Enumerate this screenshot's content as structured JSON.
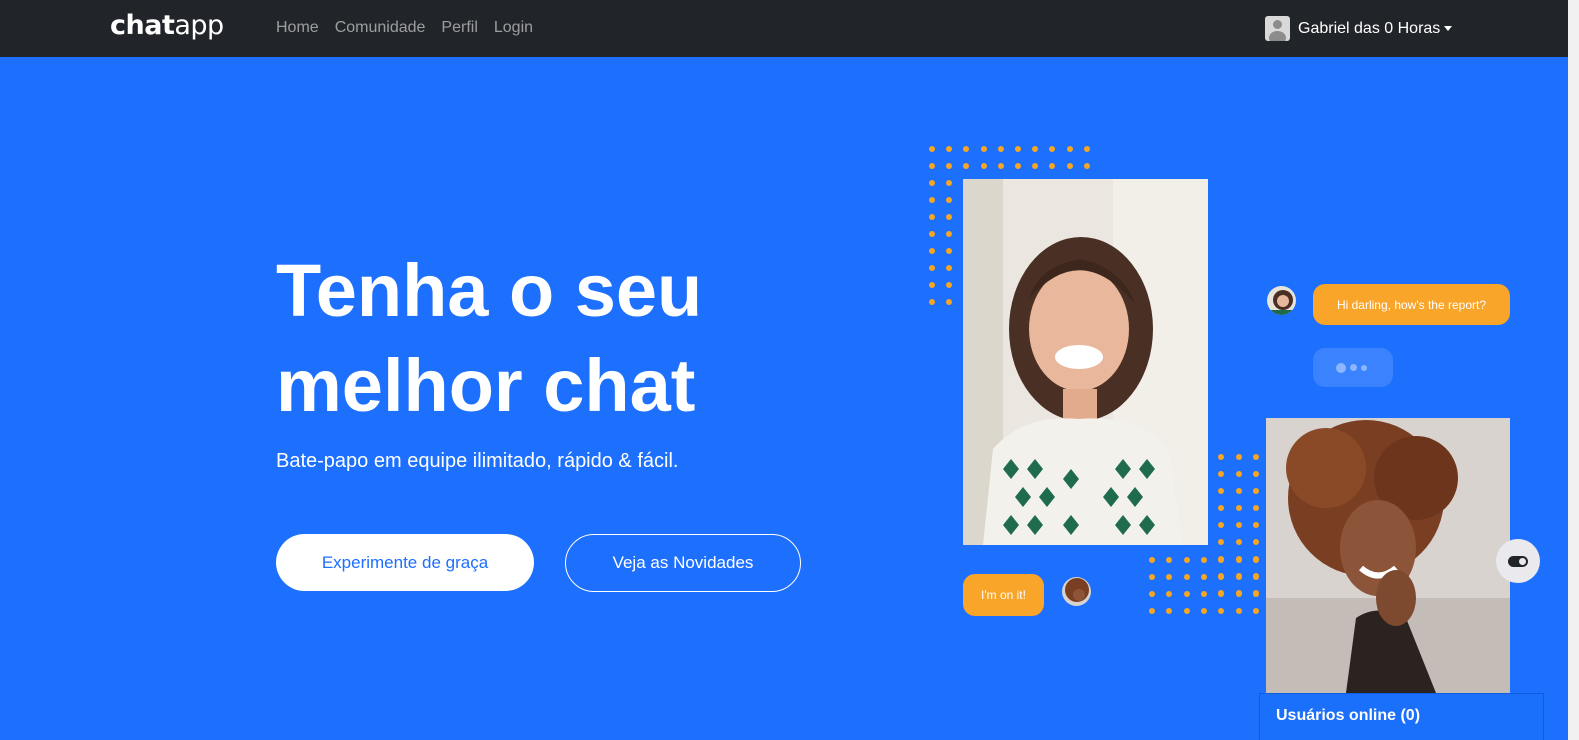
{
  "navbar": {
    "brand_bold": "chat",
    "brand_light": "app",
    "links": [
      "Home",
      "Comunidade",
      "Perfil",
      "Login"
    ],
    "user_name": "Gabriel das 0 Horas"
  },
  "hero": {
    "title_line1": "Tenha o seu",
    "title_line2": "melhor chat",
    "subtitle": "Bate-papo em equipe ilimitado, rápido & fácil.",
    "primary_button": "Experimente de graça",
    "secondary_button": "Veja as Novidades"
  },
  "chat": {
    "bubble_hi": "Hi darling, how's the report?",
    "bubble_on": "I'm on it!"
  },
  "online_panel": {
    "label": "Usuários online (0)"
  },
  "colors": {
    "background": "#1d6ffe",
    "navbar": "#212529",
    "accent_orange": "#f8a52a"
  },
  "icons": [
    "user-avatar-icon",
    "caret-down-icon",
    "toggle-icon",
    "typing-dots-icon"
  ]
}
